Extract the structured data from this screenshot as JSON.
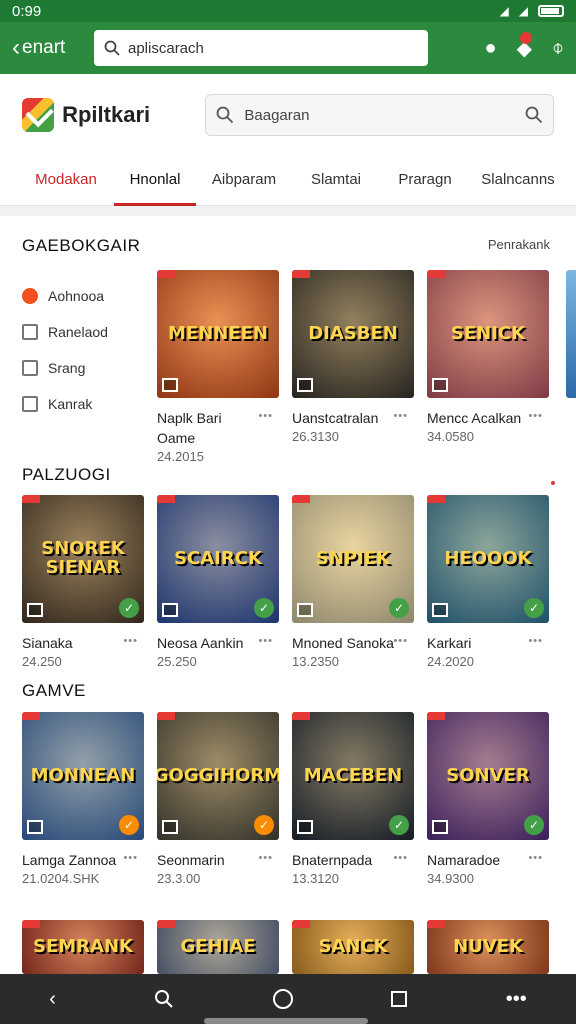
{
  "status": {
    "time": "0:99"
  },
  "topbar": {
    "back_label": "enart",
    "url_value": "apliscarach"
  },
  "apphead": {
    "brand": "Rpiltkari",
    "search_placeholder": "Baagaran"
  },
  "tabs": [
    "Modakan",
    "Hnonlal",
    "Aibparam",
    "Slamtai",
    "Praragn",
    "Slalncanns"
  ],
  "section1": {
    "title": "GAEBOKGAIR",
    "more": "Penrakank"
  },
  "categories": [
    "Aohnooa",
    "Ranelaod",
    "Srang",
    "Kanrak"
  ],
  "section2": {
    "title": "PALZUOGI"
  },
  "section3": {
    "title": "GAMVE"
  },
  "cards": [
    {
      "art": "MENNEEN",
      "title": "Naplk Bari Oame",
      "sub": "24.2015",
      "dots": "•••",
      "bg": "#d9531e",
      "badge": ""
    },
    {
      "art": "DIASBEN",
      "title": "Uanstcatralan",
      "sub": "26.3130",
      "dots": "•••",
      "bg": "#3a3630",
      "badge": ""
    },
    {
      "art": "SENICK",
      "title": "Mencc Acalkan",
      "sub": "34.0580",
      "dots": "•••",
      "bg": "#c05a6a",
      "badge": ""
    },
    {
      "art": "SNOREK SIENAR",
      "title": "Sianaka",
      "sub": "24.250",
      "dots": "•••",
      "bg": "#4a3a2c",
      "badge": "green"
    },
    {
      "art": "SCAIRCK",
      "title": "Neosa Aankin",
      "sub": "25.250",
      "dots": "•••",
      "bg": "#2b4fa8",
      "badge": "green"
    },
    {
      "art": "SNPIEK",
      "title": "Mnoned Sanoka",
      "sub": "13.2350",
      "dots": "•••",
      "bg": "#d9cfa8",
      "badge": "green"
    },
    {
      "art": "HEOOOK",
      "title": "Karkari",
      "sub": "24.2020",
      "dots": "•••",
      "bg": "#2f7aa0",
      "badge": "green"
    },
    {
      "art": "MONNEAN",
      "title": "Lamga Zannoa",
      "sub": "21.0204.SHK",
      "dots": "•••",
      "bg": "#3b6fb8",
      "badge": "orange"
    },
    {
      "art": "GOGGIHORM",
      "title": "Seonmarin",
      "sub": "23.3.00",
      "dots": "•••",
      "bg": "#4c4a40",
      "badge": "orange"
    },
    {
      "art": "MACEBEN",
      "title": "Bnaternpada",
      "sub": "13.3120",
      "dots": "•••",
      "bg": "#1f2a3a",
      "badge": "green"
    },
    {
      "art": "SONVER",
      "title": "Namaradoe",
      "sub": "34.9300",
      "dots": "•••",
      "bg": "#5a2f8a",
      "badge": "green"
    },
    {
      "art": "SEMRANK",
      "title": "",
      "sub": "",
      "dots": "",
      "bg": "#b23a2a",
      "badge": ""
    },
    {
      "art": "GEHIAE",
      "title": "",
      "sub": "",
      "dots": "",
      "bg": "#6a7a9a",
      "badge": ""
    },
    {
      "art": "SANCK",
      "title": "",
      "sub": "",
      "dots": "",
      "bg": "#d08a2a",
      "badge": ""
    },
    {
      "art": "NUVEK",
      "title": "",
      "sub": "",
      "dots": "",
      "bg": "#c0532a",
      "badge": ""
    }
  ]
}
